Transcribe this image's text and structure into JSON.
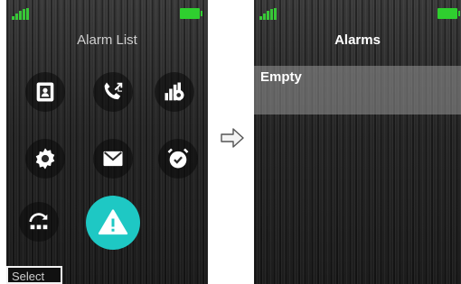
{
  "left_screen": {
    "title": "Alarm List",
    "softkey_label": "Select",
    "menu_icons": [
      "contacts-icon",
      "call-log-icon",
      "connectivity-settings-icon",
      "settings-icon",
      "messages-icon",
      "alarm-clock-icon",
      "profiles-icon",
      "alarm-warning-icon"
    ],
    "selected_icon": "alarm-warning-icon"
  },
  "right_screen": {
    "title": "Alarms",
    "list_items": [
      "Empty"
    ]
  },
  "colors": {
    "signal": "#37c837",
    "battery": "#2fcf2f",
    "selected_accent": "#1ec8c4",
    "highlight_row": "#8a8a8a"
  }
}
